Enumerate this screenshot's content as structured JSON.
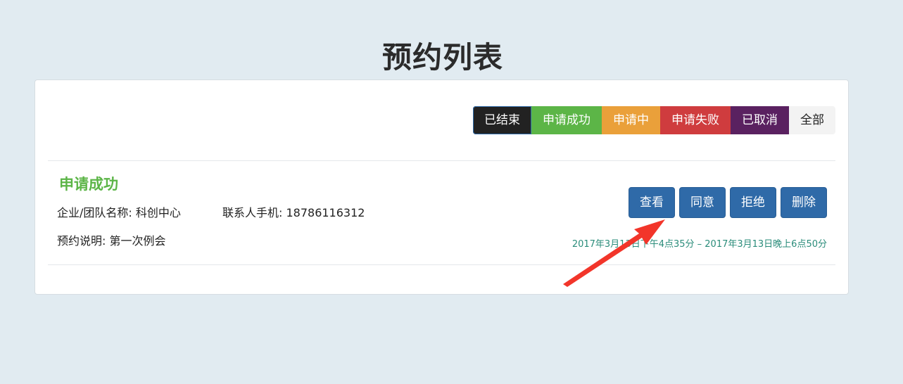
{
  "page": {
    "title": "预约列表"
  },
  "filters": [
    {
      "label": "已结束",
      "color": "#222222",
      "border": "#2f6aa8"
    },
    {
      "label": "申请成功",
      "color": "#5cb547"
    },
    {
      "label": "申请中",
      "color": "#eaa03a"
    },
    {
      "label": "申请失败",
      "color": "#cf3c3e"
    },
    {
      "label": "已取消",
      "color": "#5a2160"
    },
    {
      "label": "全部",
      "color": "#f3f3f3",
      "text_color": "#222222"
    }
  ],
  "record": {
    "status": "申请成功",
    "status_color": "#5cb547",
    "company": "企业/团队名称: 科创中心",
    "phone": "联系人手机: 18786116312",
    "description": "预约说明: 第一次例会",
    "time_range": "2017年3月13日下午4点35分 – 2017年3月13日晚上6点50分",
    "actions": {
      "view": "查看",
      "agree": "同意",
      "reject": "拒绝",
      "delete": "删除"
    }
  },
  "annotation": {
    "arrow_color": "#f2352a",
    "icon": "red-arrow-icon"
  }
}
